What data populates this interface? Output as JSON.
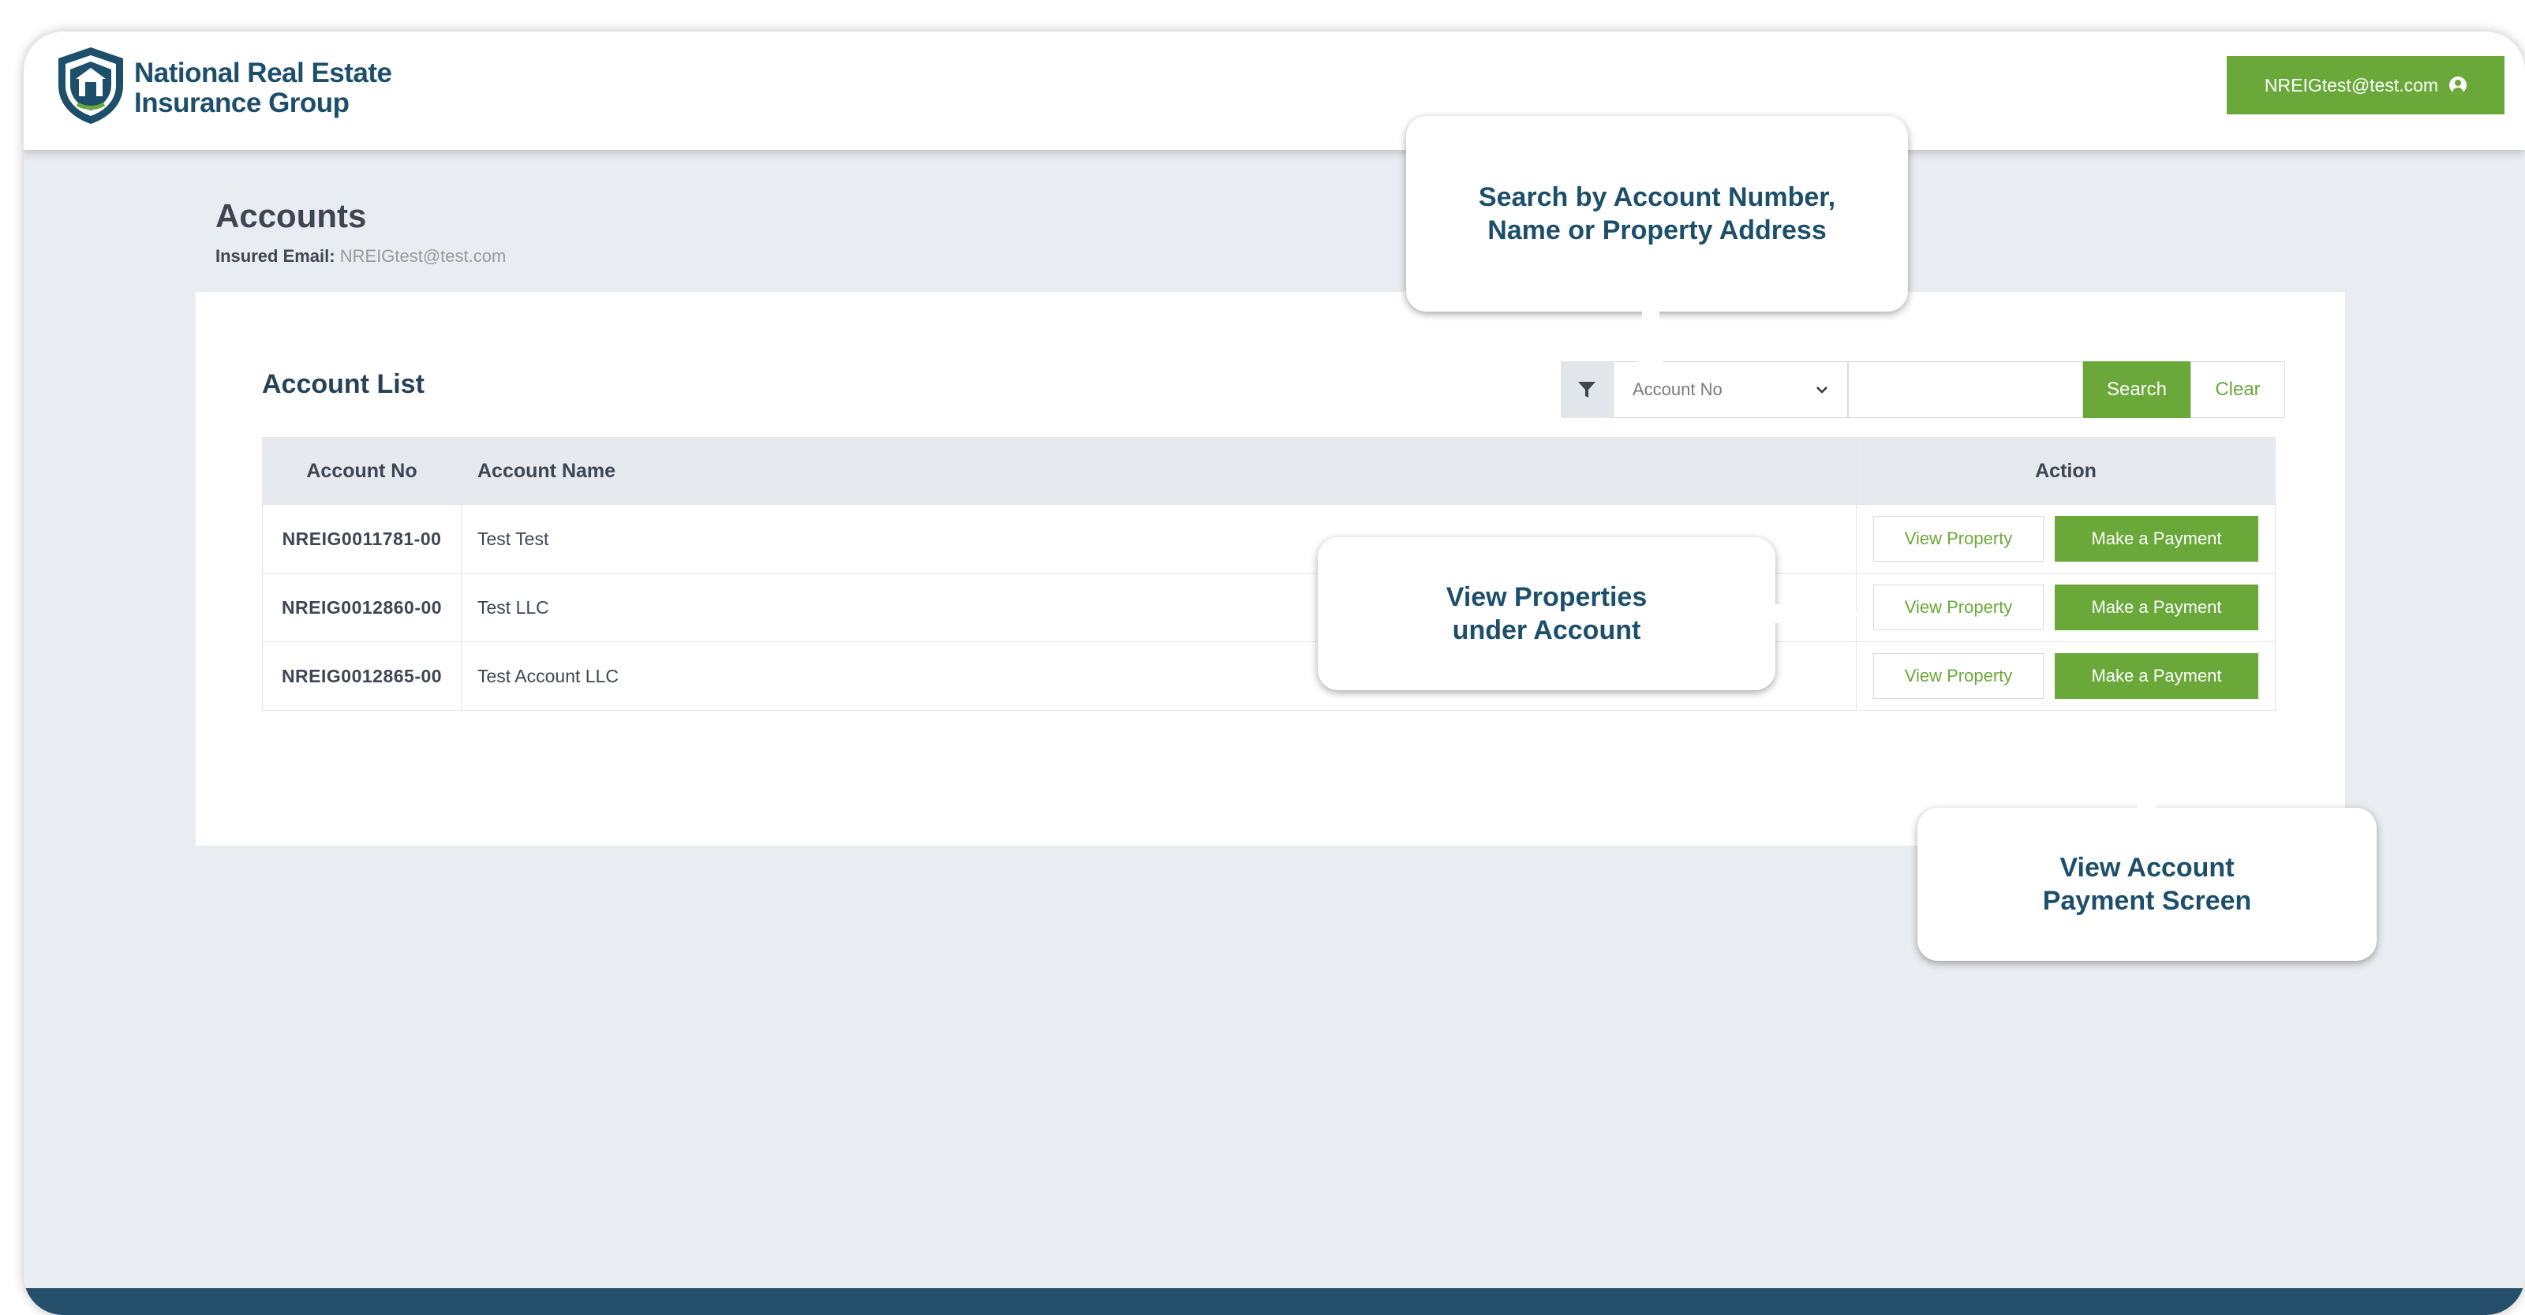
{
  "header": {
    "brand_line1": "National Real Estate",
    "brand_line2": "Insurance Group",
    "user_email": "NREIGtest@test.com"
  },
  "page": {
    "title": "Accounts",
    "insured_label": "Insured Email:",
    "insured_value": "NREIGtest@test.com"
  },
  "account_list": {
    "title": "Account List",
    "filter_select_value": "Account No",
    "search_value": "",
    "search_label": "Search",
    "clear_label": "Clear",
    "columns": [
      "Account No",
      "Account Name",
      "Action"
    ],
    "rows": [
      {
        "account_no": "NREIG0011781-00",
        "account_name": "Test Test",
        "view_label": "View Property",
        "pay_label": "Make a Payment"
      },
      {
        "account_no": "NREIG0012860-00",
        "account_name": "Test LLC",
        "view_label": "View Property",
        "pay_label": "Make a Payment"
      },
      {
        "account_no": "NREIG0012865-00",
        "account_name": "Test Account LLC",
        "view_label": "View Property",
        "pay_label": "Make a Payment"
      }
    ]
  },
  "callouts": {
    "search": {
      "line1": "Search by Account Number,",
      "line2": "Name or Property Address"
    },
    "view_properties": {
      "line1": "View Properties",
      "line2": "under Account"
    },
    "payment": {
      "line1": "View Account",
      "line2": "Payment Screen"
    }
  },
  "colors": {
    "accent_green": "#6aa83a",
    "brand_navy": "#1d4f6b",
    "background": "#e9ecf1"
  },
  "icons": [
    "shield-house-logo-icon",
    "user-circle-icon",
    "filter-icon",
    "chevron-down-icon",
    "arrow-icon"
  ]
}
